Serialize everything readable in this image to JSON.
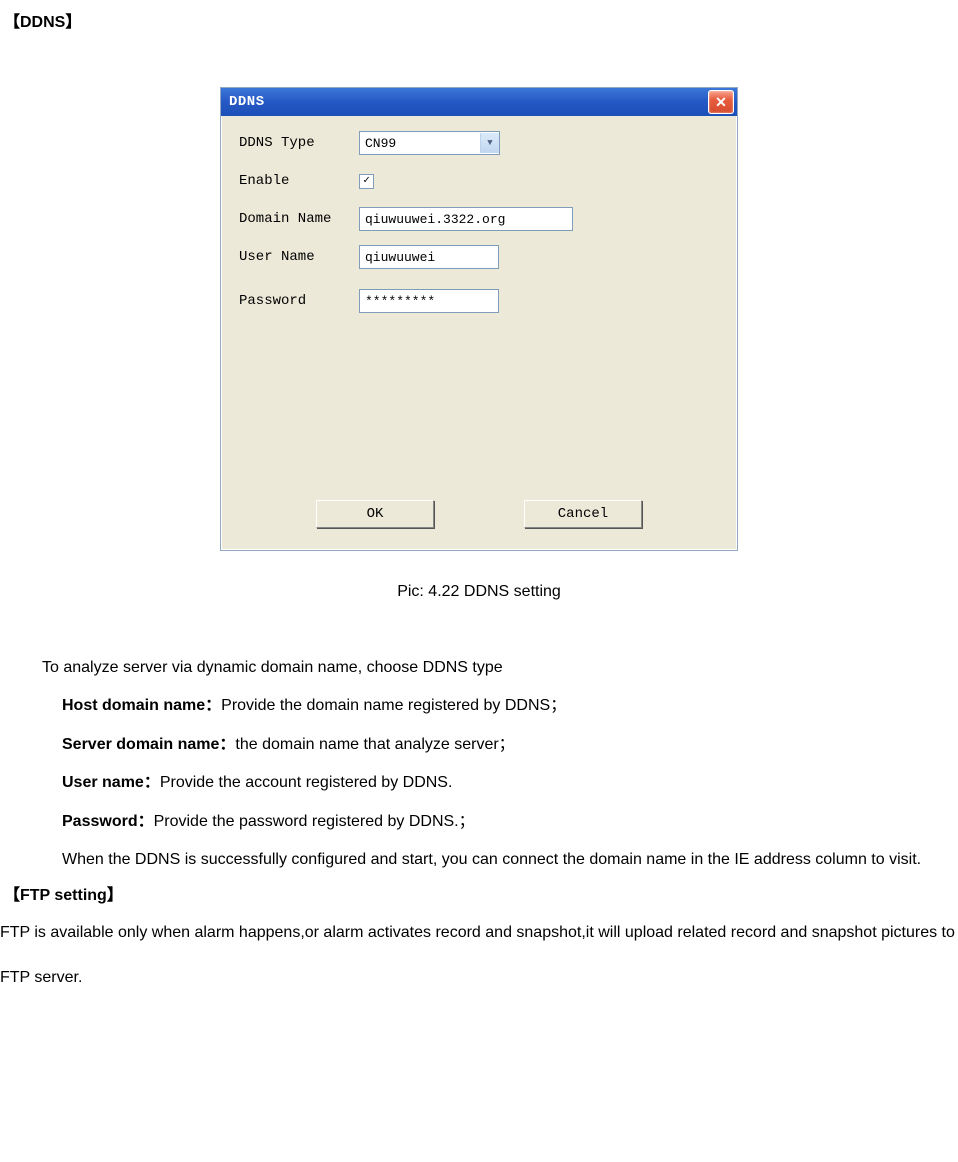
{
  "heading_ddns": "【DDNS】",
  "dialog": {
    "title": "DDNS",
    "fields": {
      "type_label": "DDNS Type",
      "type_value": "CN99",
      "enable_label": "Enable",
      "enable_checked": "✓",
      "domain_label": "Domain Name",
      "domain_value": "qiuwuuwei.3322.org",
      "user_label": "User Name",
      "user_value": "qiuwuuwei",
      "pass_label": "Password",
      "pass_value": "*********"
    },
    "ok": "OK",
    "cancel": "Cancel"
  },
  "caption": "Pic: 4.22 DDNS setting",
  "para_intro": "To analyze server via dynamic domain name, choose DDNS type",
  "defs": {
    "host_label": "Host domain name：",
    "host_text": "Provide the domain name registered by DDNS；",
    "server_label": "Server domain name：",
    "server_text": "the domain name that analyze server；",
    "user_label": "User name：",
    "user_text": "Provide the account registered by DDNS.",
    "pass_label": "Password：",
    "pass_text": "Provide the password registered by DDNS.；"
  },
  "para_success": "When the DDNS is successfully configured and start, you can connect the domain name in the IE address column to visit.",
  "heading_ftp": "【FTP setting】",
  "ftp_text": "FTP is available only when alarm happens,or alarm activates record and snapshot,it will upload related record and snapshot pictures to FTP server."
}
